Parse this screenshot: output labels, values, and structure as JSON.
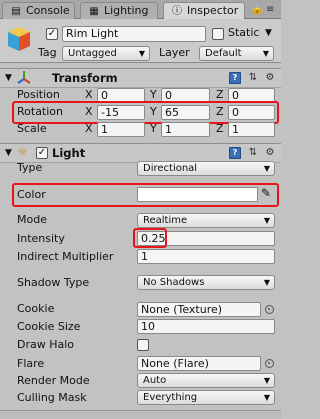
{
  "tabs": [
    {
      "label": "Console",
      "icon": "console-icon"
    },
    {
      "label": "Lighting",
      "icon": "lighting-icon"
    },
    {
      "label": "Inspector",
      "icon": "inspector-icon"
    }
  ],
  "object": {
    "name": "Rim Light",
    "active": true,
    "static_label": "Static",
    "static": false,
    "tag_label": "Tag",
    "tag_value": "Untagged",
    "layer_label": "Layer",
    "layer_value": "Default"
  },
  "transform": {
    "title": "Transform",
    "position": {
      "label": "Position",
      "x": "0",
      "y": "0",
      "z": "0"
    },
    "rotation": {
      "label": "Rotation",
      "x": "-15",
      "y": "65",
      "z": "0"
    },
    "scale": {
      "label": "Scale",
      "x": "1",
      "y": "1",
      "z": "1"
    },
    "axis_x": "X",
    "axis_y": "Y",
    "axis_z": "Z"
  },
  "light": {
    "title": "Light",
    "enabled": true,
    "type_label": "Type",
    "type_value": "Directional",
    "color_label": "Color",
    "color_value": "#ffffff",
    "mode_label": "Mode",
    "mode_value": "Realtime",
    "intensity_label": "Intensity",
    "intensity_value": "0.25",
    "indirect_label": "Indirect Multiplier",
    "indirect_value": "1",
    "shadow_label": "Shadow Type",
    "shadow_value": "No Shadows",
    "cookie_label": "Cookie",
    "cookie_value": "None (Texture)",
    "cookie_size_label": "Cookie Size",
    "cookie_size_value": "10",
    "draw_halo_label": "Draw Halo",
    "draw_halo": false,
    "flare_label": "Flare",
    "flare_value": "None (Flare)",
    "render_mode_label": "Render Mode",
    "render_mode_value": "Auto",
    "culling_label": "Culling Mask",
    "culling_value": "Everything"
  },
  "colors": {
    "highlight": "#e8141c",
    "accent_blue": "#3a6fb8"
  }
}
